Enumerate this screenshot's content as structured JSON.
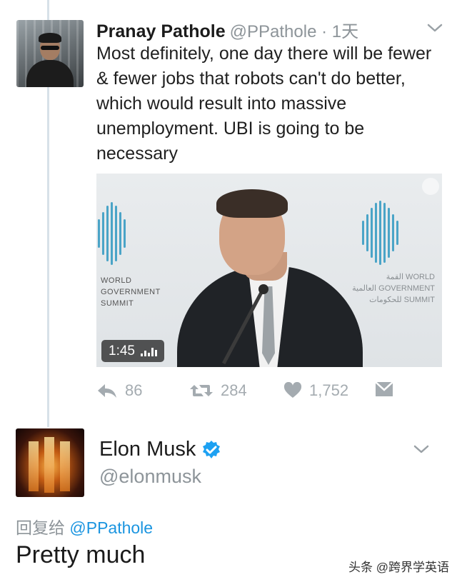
{
  "tweet1": {
    "display_name": "Pranay Pathole",
    "handle": "@PPathole",
    "separator": "·",
    "time": "1天",
    "text": "Most definitely, one day there will be fewer & fewer jobs that robots can't do better, which would result into massive unemployment. UBI is going to be necessary",
    "video": {
      "duration": "1:45",
      "logo_left": [
        "WORLD",
        "GOVERNMENT",
        "SUMMIT"
      ],
      "logo_right": [
        "القمة WORLD",
        "العالمية GOVERNMENT",
        "للحكومات SUMMIT"
      ]
    },
    "actions": {
      "replies": "86",
      "retweets": "284",
      "likes": "1,752"
    }
  },
  "tweet2": {
    "display_name": "Elon Musk",
    "handle": "@elonmusk",
    "reply_prefix": "回复给",
    "reply_to": "@PPathole",
    "text": "Pretty much"
  },
  "watermark": "头条 @跨界学英语",
  "colors": {
    "muted": "#8d9499",
    "link": "#1b95e0",
    "verified": "#1da1f2",
    "thread_line": "#d7e1e8"
  },
  "icons": [
    "chevron-down-icon",
    "reply-icon",
    "retweet-icon",
    "heart-icon",
    "direct-message-icon",
    "verified-badge-icon",
    "audio-bars-icon"
  ]
}
